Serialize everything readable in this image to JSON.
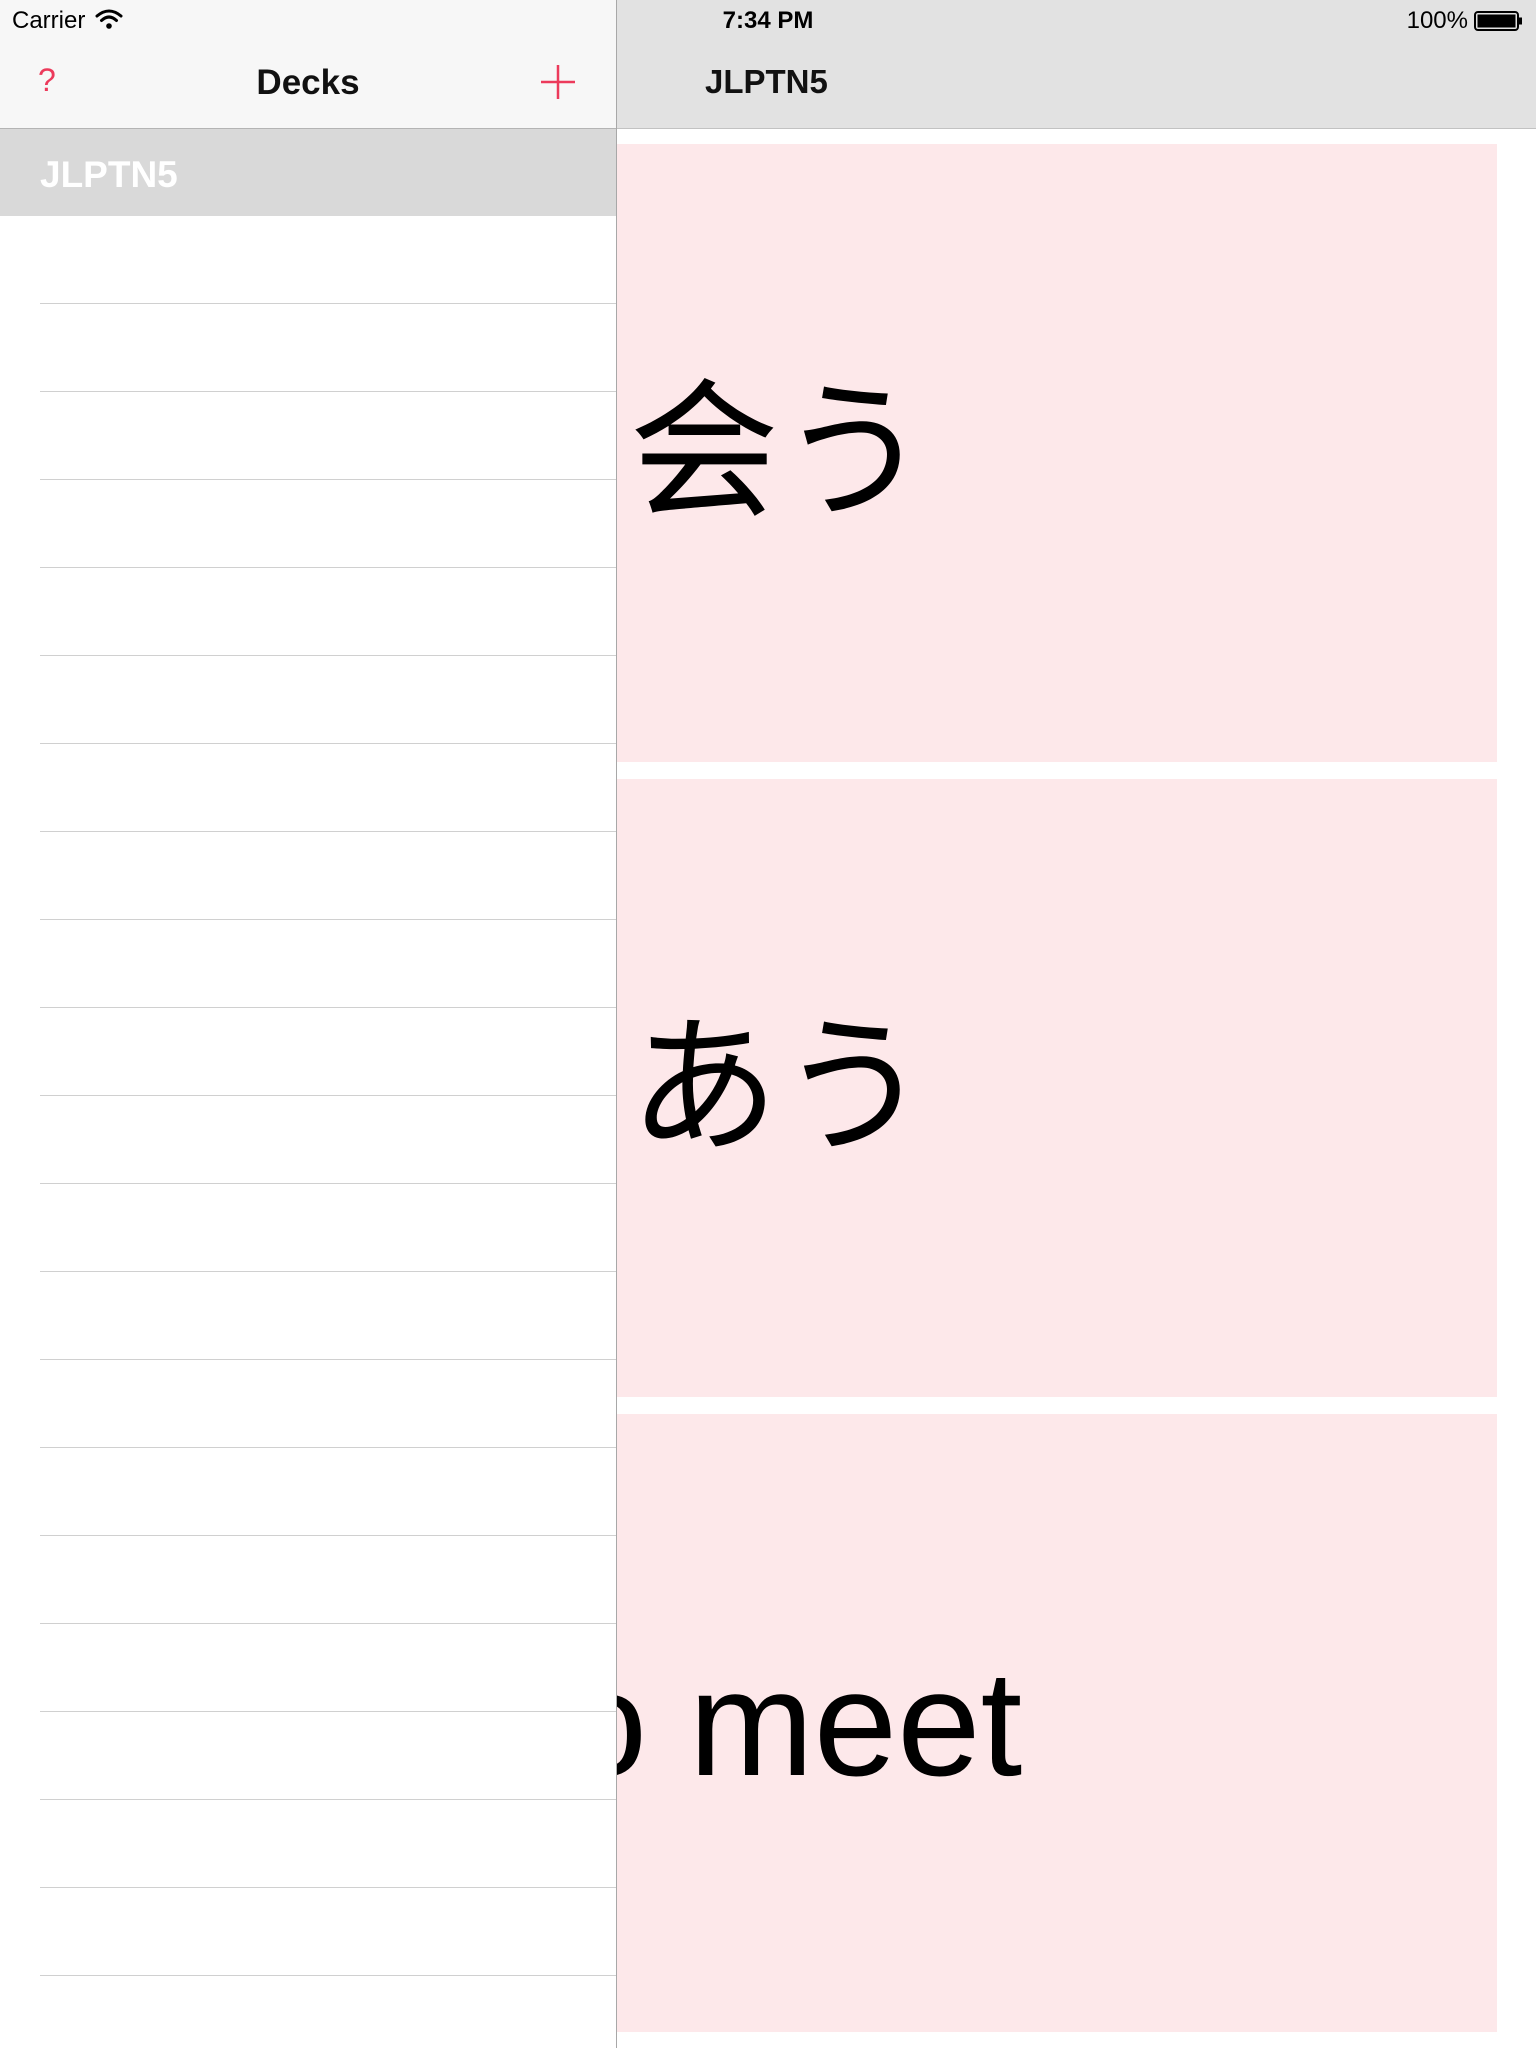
{
  "status_bar": {
    "carrier": "Carrier",
    "time": "7:34 PM",
    "battery": "100%"
  },
  "master": {
    "title": "Decks",
    "help_label": "?",
    "decks": [
      {
        "label": "JLPTN5",
        "selected": true
      }
    ]
  },
  "detail": {
    "title": "JLPTN5",
    "cards": [
      {
        "text": "会う"
      },
      {
        "text": "あう"
      },
      {
        "text": "to meet"
      }
    ]
  },
  "colors": {
    "accent": "#ec3a5b",
    "card_background": "#fde8ea",
    "selected_row": "#d9d9d9"
  }
}
